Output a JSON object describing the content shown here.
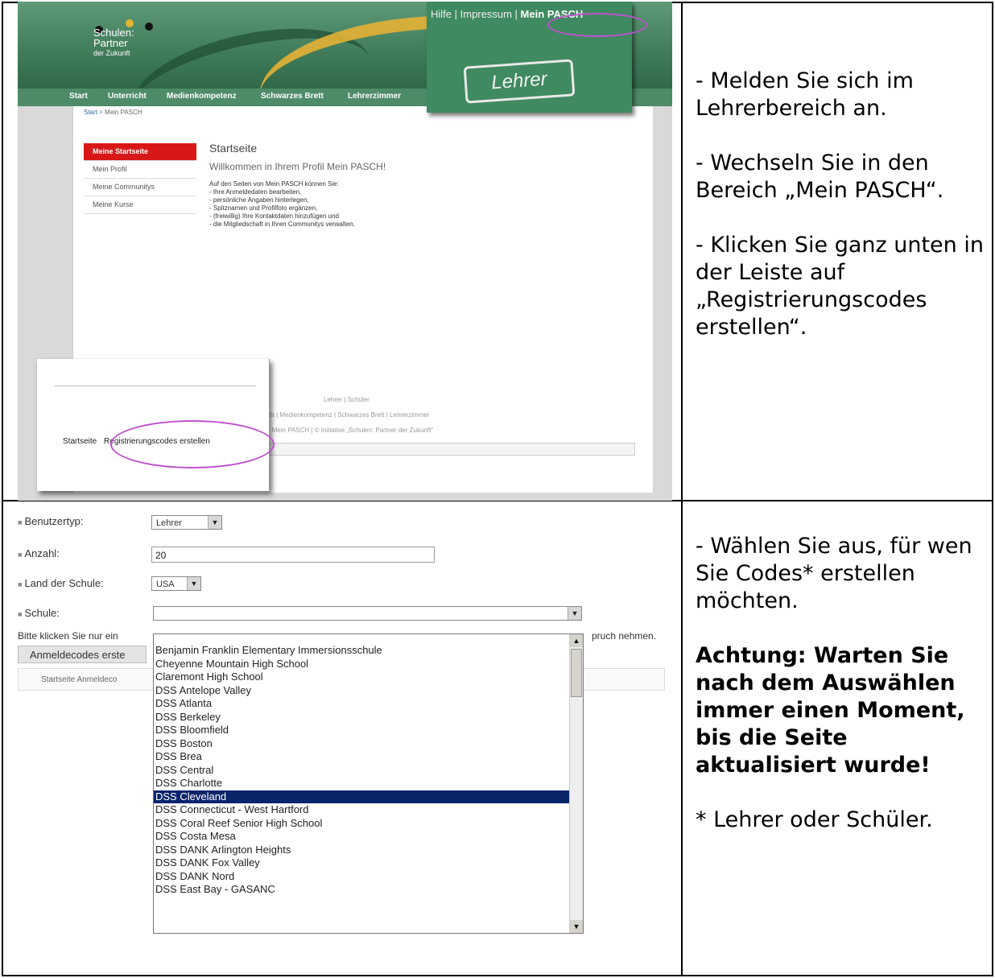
{
  "steps": {
    "top": [
      "- Melden Sie sich im Lehrerbereich an.",
      "- Wechseln Sie in den Bereich „Mein PASCH“.",
      "- Klicken Sie ganz unten in der Leiste auf „Registrierungscodes erstellen“."
    ],
    "bottom_intro": "- Wählen Sie aus, für wen Sie Codes* erstellen möchten.",
    "bottom_warning": "Achtung: Warten Sie nach dem Auswählen immer einen Moment, bis die Seite aktualisiert wurde!",
    "bottom_footnote": "* Lehrer oder Schüler."
  },
  "portal": {
    "logo": {
      "line1": "Schulen:",
      "line2": "Partner",
      "line3": "der Zukunft"
    },
    "toplinks": {
      "help": "Hilfe",
      "sep1": " | ",
      "imprint": "Impressum",
      "sep2": " | ",
      "mein_pasch": "Mein PASCH"
    },
    "stamp": "Lehrer",
    "nav": [
      "Start",
      "Unterricht",
      "Medienkompetenz",
      "Schwarzes Brett",
      "Lehrerzimmer"
    ],
    "breadcrumb": {
      "home": "Start",
      "sep": " > ",
      "current": "Mein PASCH"
    },
    "sidebar": [
      "Meine Startseite",
      "Mein Profil",
      "Meine Communitys",
      "Meine Kurse"
    ],
    "page_title": "Startseite",
    "welcome": "Willkommen in Ihrem Profil Mein PASCH!",
    "intro_lines": [
      "Auf den Seiten von Mein PASCH können Sie:",
      "- Ihre Anmeldedaten bearbeiten,",
      "- persönliche Angaben hinterlegen,",
      "- Spitznamen und Profilfoto ergänzen,",
      "- (freiwillig) Ihre Kontaktdaten hinzufügen und",
      "- die Mitgliedschaft in Ihren Communitys verwalten."
    ],
    "footer_lines": [
      "Lehrer | Schüler",
      "nterricht | Medienkompetenz | Schwarzes Brett | Lehrerzimmer",
      "ssum | Mein PASCH | © Initiative „Schulen: Partner der Zukunft“"
    ],
    "footer_popup": {
      "home": "Startseite",
      "create_codes": "Registrierungscodes erstellen"
    }
  },
  "form": {
    "user_type_label": "Benutzertyp:",
    "user_type_value": "Lehrer",
    "count_label": "Anzahl:",
    "count_value": "20",
    "country_label": "Land der Schule:",
    "country_value": "USA",
    "school_label": "Schule:",
    "school_value": "",
    "note_left": "Bitte klicken Sie nur ein",
    "note_right": "pruch nehmen.",
    "submit_label": "Anmeldecodes erste",
    "minibar": "Startseite  Anmeldeco",
    "schools": [
      "Benjamin Franklin Elementary Immersionsschule",
      "Cheyenne Mountain High School",
      "Claremont High School",
      "DSS Antelope Valley",
      "DSS Atlanta",
      "DSS Berkeley",
      "DSS Bloomfield",
      "DSS Boston",
      "DSS Brea",
      "DSS Central",
      "DSS Charlotte",
      "DSS Cleveland",
      "DSS Connecticut - West Hartford",
      "DSS Coral Reef Senior High School",
      "DSS Costa Mesa",
      "DSS DANK Arlington Heights",
      "DSS DANK Fox Valley",
      "DSS DANK Nord",
      "DSS East Bay - GASANC"
    ],
    "selected_school": "DSS Cleveland"
  },
  "icons": {
    "dropdown": "dropdown-arrow-icon",
    "scroll_up": "scroll-up-icon",
    "scroll_down": "scroll-down-icon"
  },
  "colors": {
    "portal_green": "#3f8a60",
    "active_red": "#d81818",
    "highlight_oval": "#c050d0",
    "selection_blue": "#0a246a"
  }
}
